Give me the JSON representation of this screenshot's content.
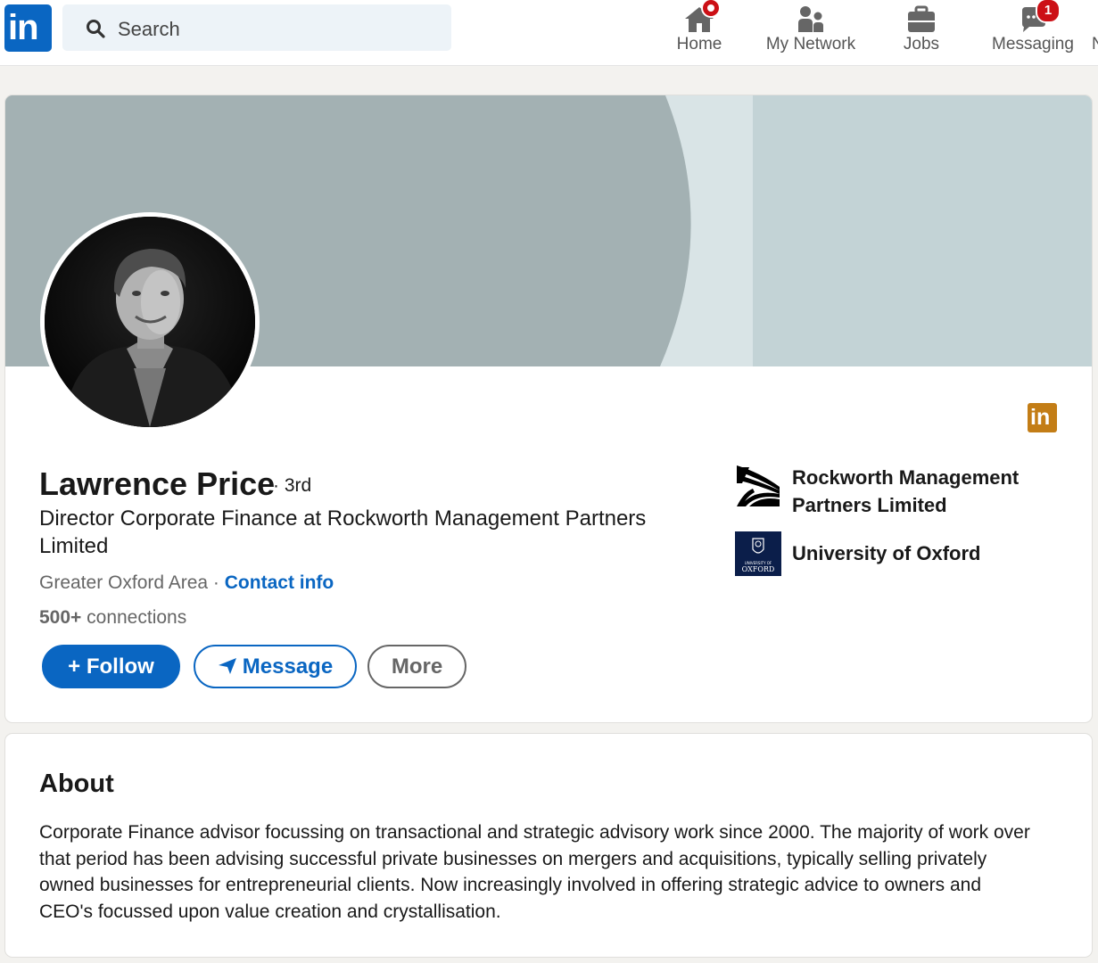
{
  "nav": {
    "logo_text": "in",
    "search_placeholder": "Search",
    "items": [
      {
        "label": "Home",
        "icon": "home-icon",
        "badge": ""
      },
      {
        "label": "My Network",
        "icon": "network-icon",
        "badge": ""
      },
      {
        "label": "Jobs",
        "icon": "briefcase-icon",
        "badge": ""
      },
      {
        "label": "Messaging",
        "icon": "chat-icon",
        "badge": "1"
      }
    ],
    "overflow_label": "N"
  },
  "profile": {
    "name": "Lawrence Price",
    "degree": "· 3rd",
    "headline": "Director Corporate Finance at Rockworth Management Partners Limited",
    "location": "Greater Oxford Area",
    "separator": " · ",
    "contact_label": "Contact info",
    "connections_count": "500+",
    "connections_label": " connections",
    "buttons": {
      "follow": "+ Follow",
      "message": "Message",
      "more": "More"
    },
    "badge_text": "in",
    "organizations": [
      {
        "name": "Rockworth Management Partners Limited",
        "icon": "rockworth-logo"
      },
      {
        "name": "University of Oxford",
        "icon": "oxford-logo"
      }
    ],
    "oxford_logo_text": {
      "line1": "UNIVERSITY OF",
      "line2": "OXFORD"
    }
  },
  "about": {
    "title": "About",
    "text": "Corporate Finance advisor focussing on transactional and strategic advisory work since 2000. The majority of work over that period has been advising successful private businesses on mergers and acquisitions, typically selling privately owned businesses for entrepreneurial clients. Now increasingly involved in offering strategic advice to owners and CEO's focussed upon value creation and crystallisation."
  },
  "colors": {
    "brand": "#0a66c2",
    "banner_dark": "#a3b1b3",
    "banner_light": "#c3d3d6",
    "notification": "#cc1016",
    "premium_badge": "#c37d16"
  }
}
